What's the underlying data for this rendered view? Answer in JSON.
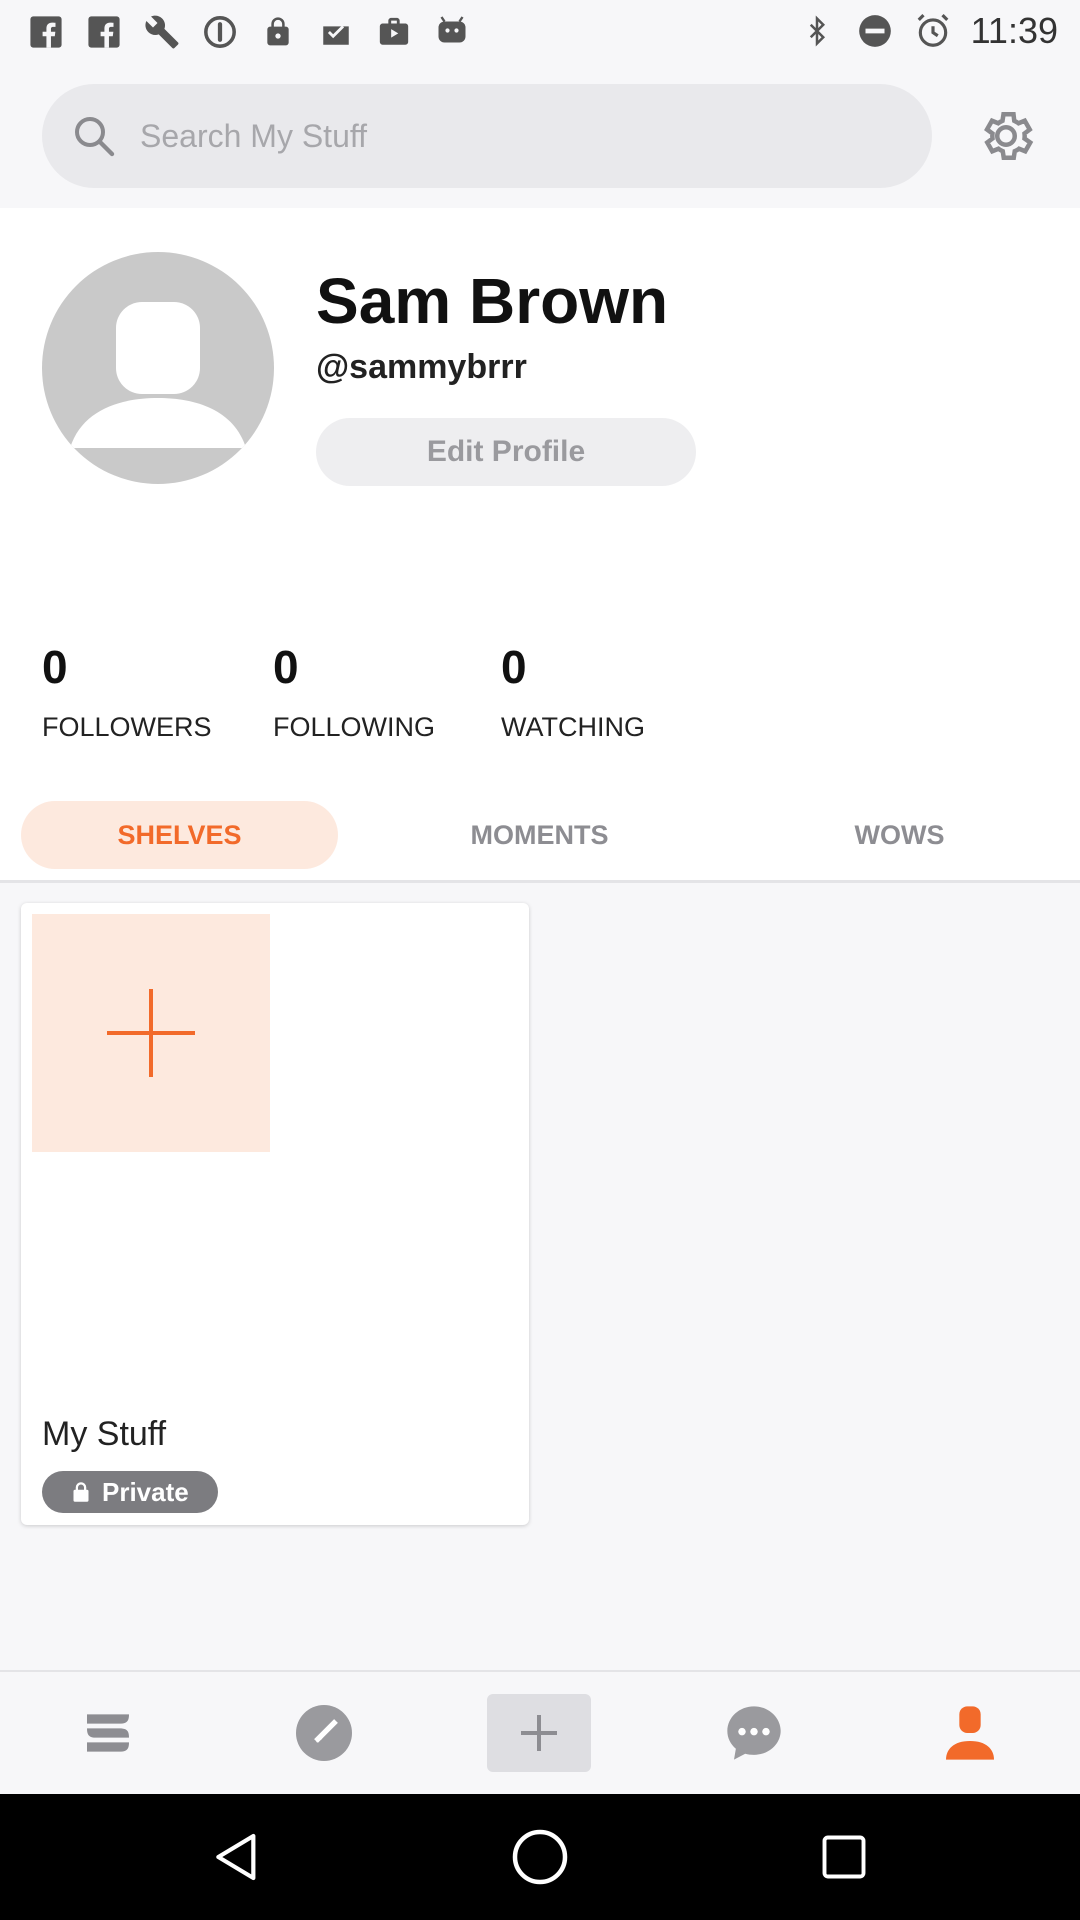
{
  "status_bar": {
    "time": "11:39",
    "icons_left": [
      "facebook-icon",
      "facebook-icon",
      "wrench-icon",
      "sync-icon",
      "lock-icon",
      "mail-check-icon",
      "briefcase-icon",
      "android-icon"
    ],
    "icons_right": [
      "bluetooth-icon",
      "do-not-disturb-icon",
      "alarm-icon"
    ]
  },
  "search": {
    "placeholder": "Search My Stuff",
    "value": ""
  },
  "profile": {
    "name": "Sam Brown",
    "handle": "@sammybrrr",
    "edit_label": "Edit Profile"
  },
  "stats": [
    {
      "value": "0",
      "label": "FOLLOWERS"
    },
    {
      "value": "0",
      "label": "FOLLOWING"
    },
    {
      "value": "0",
      "label": "WATCHING"
    }
  ],
  "tabs": [
    {
      "label": "SHELVES",
      "active": true
    },
    {
      "label": "MOMENTS",
      "active": false
    },
    {
      "label": "WOWS",
      "active": false
    }
  ],
  "shelf": {
    "title": "My Stuff",
    "badge": "Private"
  },
  "bottom_nav": [
    "home-icon",
    "explore-icon",
    "add-icon",
    "messages-icon",
    "profile-icon"
  ],
  "colors": {
    "accent": "#f26a2a",
    "accent_light": "#fde9de",
    "muted": "#8d8d92"
  }
}
